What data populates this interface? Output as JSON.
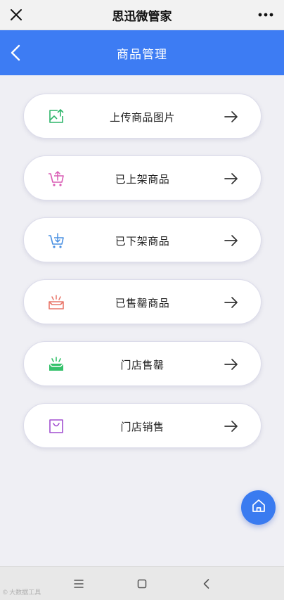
{
  "app": {
    "title": "思迅微管家"
  },
  "header": {
    "title": "商品管理"
  },
  "menu": [
    {
      "label": "上传商品图片",
      "icon": "image-upload-icon",
      "color": "#2fb56a"
    },
    {
      "label": "已上架商品",
      "icon": "cart-up-icon",
      "color": "#d95bb4"
    },
    {
      "label": "已下架商品",
      "icon": "cart-down-icon",
      "color": "#4a90e2"
    },
    {
      "label": "已售罄商品",
      "icon": "sold-out-tray-icon",
      "color": "#e9776a"
    },
    {
      "label": "门店售罄",
      "icon": "store-sold-out-icon",
      "color": "#34c16a"
    },
    {
      "label": "门店销售",
      "icon": "shopping-bag-icon",
      "color": "#a24fd0"
    }
  ],
  "watermark": "© 大数据工具",
  "colors": {
    "accent": "#3d7cf3",
    "fab": "#3a7bf0",
    "background": "#efeff4"
  }
}
